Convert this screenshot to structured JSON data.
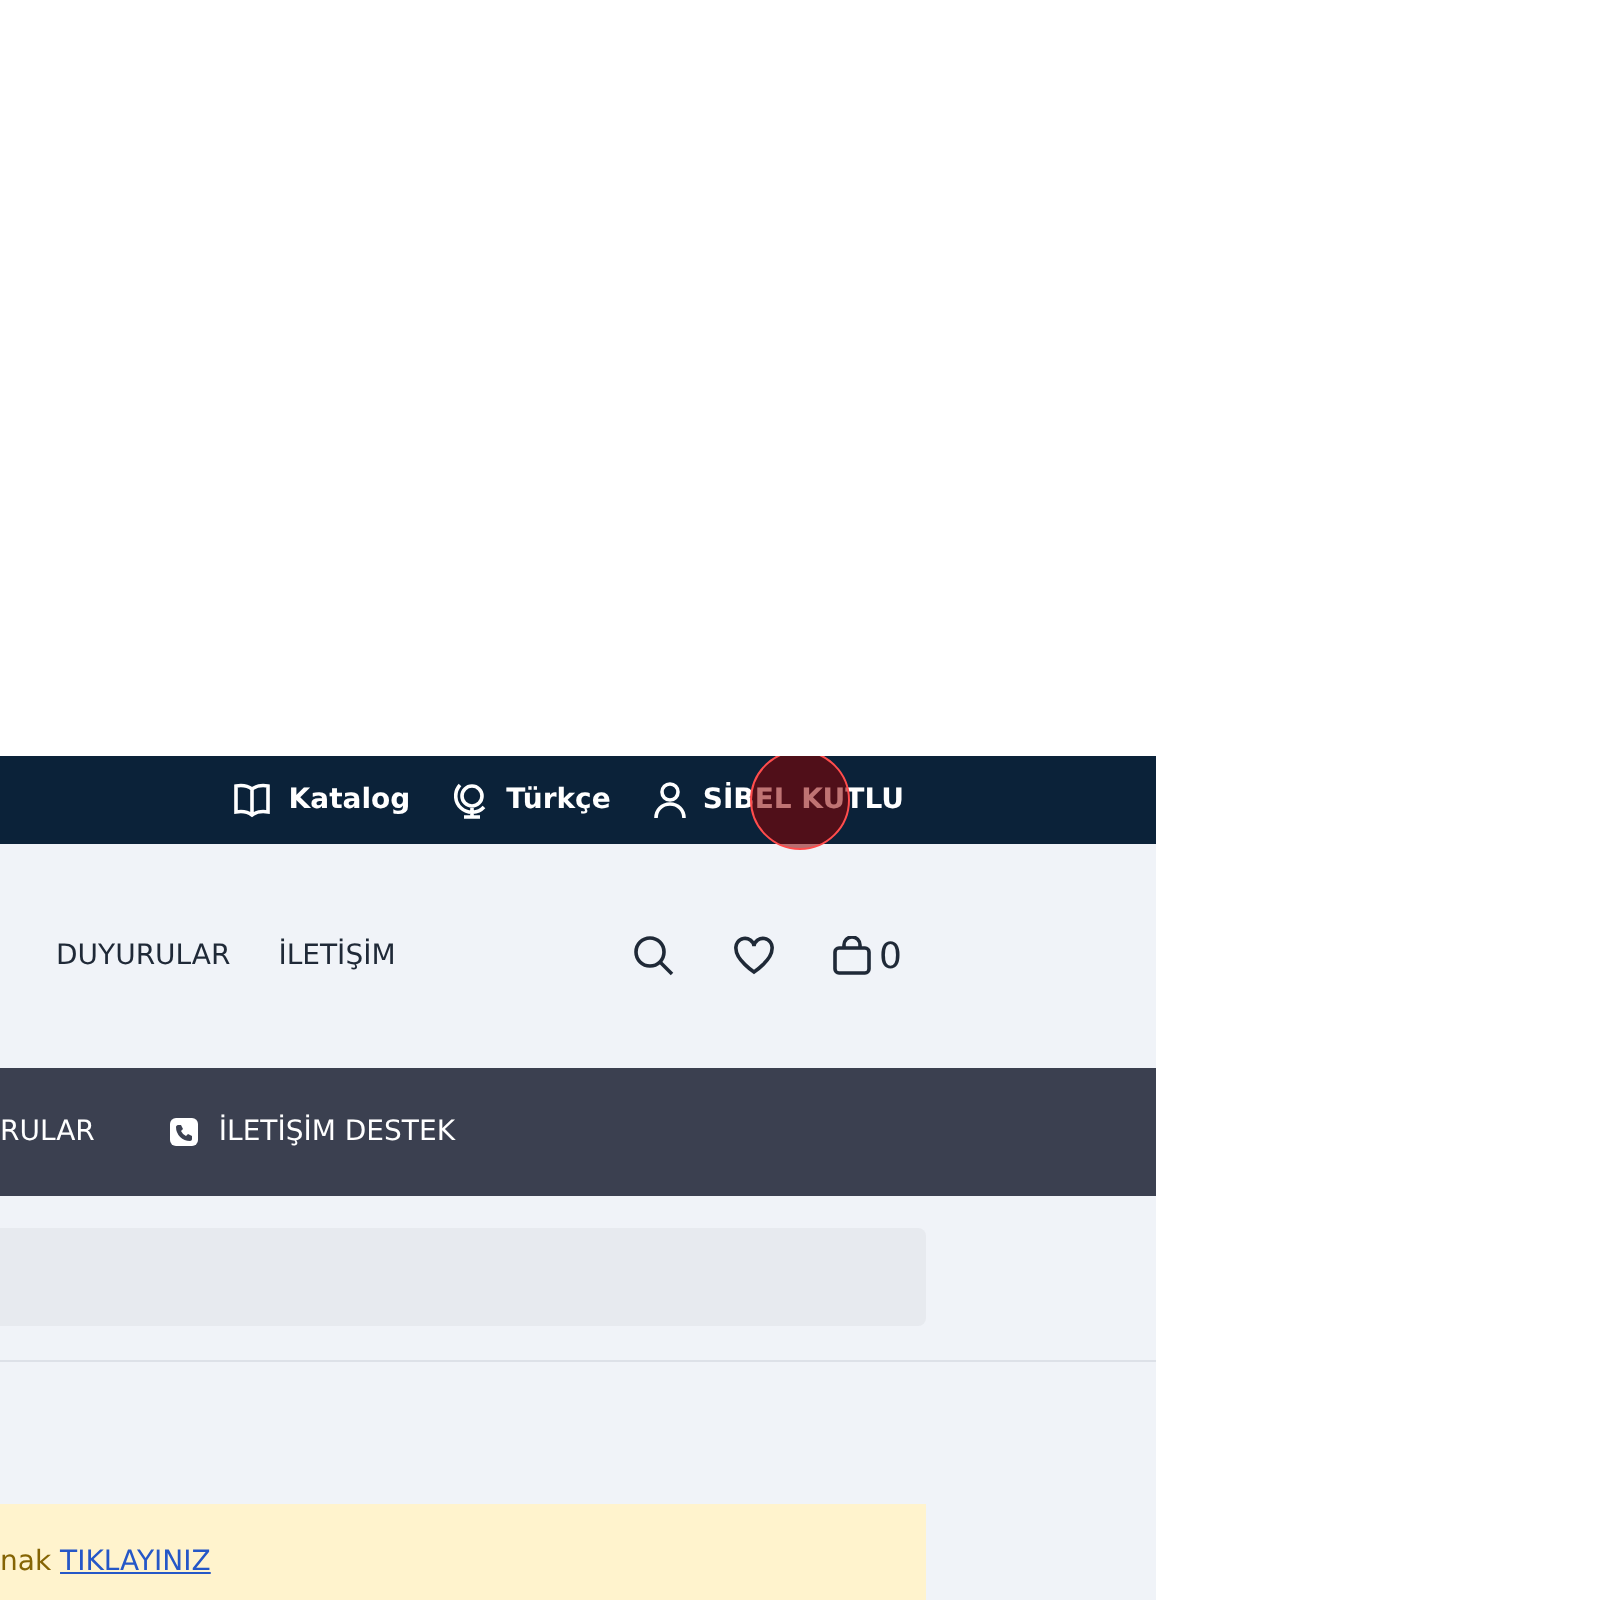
{
  "top_bar": {
    "items": [
      {
        "kind": "catalog",
        "label": "Katalog"
      },
      {
        "kind": "language",
        "label": "Türkçe"
      },
      {
        "kind": "user",
        "label": "SİBEL KUTLU"
      }
    ]
  },
  "main_nav": {
    "links": [
      "DUYURULAR",
      "İLETİŞİM"
    ],
    "cart_count": "0"
  },
  "sub_nav": {
    "items": [
      {
        "kind": "plain",
        "label": "RULAR"
      },
      {
        "kind": "phone",
        "label": "İLETİŞİM DESTEK"
      }
    ]
  },
  "notice": {
    "text": "nak",
    "link": "TIKLAYINIZ"
  },
  "click_marker": {
    "kind": "tap"
  }
}
